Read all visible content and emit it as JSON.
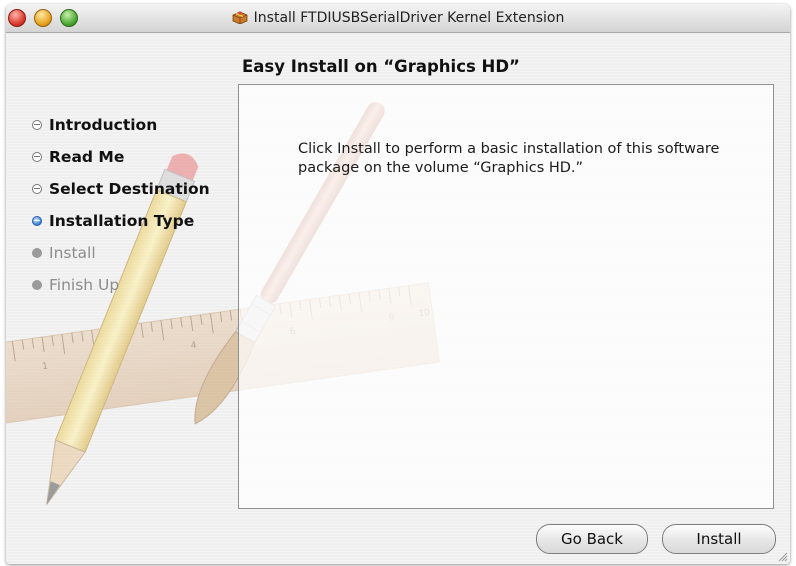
{
  "window": {
    "title": "Install FTDIUSBSerialDriver Kernel Extension",
    "title_icon": "package-icon"
  },
  "sidebar": {
    "steps": [
      {
        "label": "Introduction",
        "state": "done"
      },
      {
        "label": "Read Me",
        "state": "done"
      },
      {
        "label": "Select Destination",
        "state": "done"
      },
      {
        "label": "Installation Type",
        "state": "current"
      },
      {
        "label": "Install",
        "state": "pending"
      },
      {
        "label": "Finish Up",
        "state": "pending"
      }
    ]
  },
  "main": {
    "heading": "Easy Install on “Graphics HD”",
    "body_text": "Click Install to perform a basic installation of this software package on the volume “Graphics HD.”"
  },
  "buttons": {
    "back_label": "Go Back",
    "install_label": "Install"
  },
  "colors": {
    "current_step": "#3c7ed8",
    "pending_step": "#8c8c8c"
  }
}
